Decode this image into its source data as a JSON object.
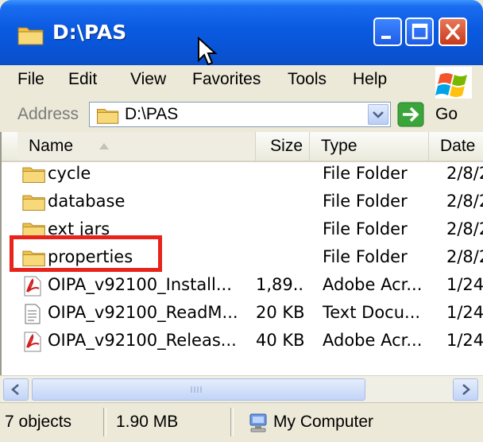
{
  "window": {
    "title": "D:\\PAS"
  },
  "menu": {
    "items": [
      "File",
      "Edit",
      "View",
      "Favorites",
      "Tools",
      "Help"
    ]
  },
  "address": {
    "label": "Address",
    "value": "D:\\PAS",
    "go_label": "Go"
  },
  "columns": {
    "name": "Name",
    "size": "Size",
    "type": "Type",
    "date": "Date"
  },
  "files": [
    {
      "name": "cycle",
      "size": "",
      "type": "File Folder",
      "date": "2/8/2",
      "icon": "folder-icon"
    },
    {
      "name": "database",
      "size": "",
      "type": "File Folder",
      "date": "2/8/2",
      "icon": "folder-icon"
    },
    {
      "name": "ext jars",
      "size": "",
      "type": "File Folder",
      "date": "2/8/2",
      "icon": "folder-icon"
    },
    {
      "name": "properties",
      "size": "",
      "type": "File Folder",
      "date": "2/8/2",
      "icon": "folder-icon"
    },
    {
      "name": "OIPA_v92100_Install...",
      "size": "1,89...",
      "type": "Adobe Acr...",
      "date": "1/24/",
      "icon": "pdf-icon"
    },
    {
      "name": "OIPA_v92100_ReadM...",
      "size": "20 KB",
      "type": "Text Docu...",
      "date": "1/24/",
      "icon": "text-document-icon"
    },
    {
      "name": "OIPA_v92100_Releas...",
      "size": "40 KB",
      "type": "Adobe Acr...",
      "date": "1/24/",
      "icon": "pdf-icon"
    }
  ],
  "status": {
    "objects": "7 objects",
    "size": "1.90 MB",
    "location": "My Computer"
  },
  "colors": {
    "titlebar": "#0a5ae0",
    "highlight": "#e8231c",
    "chrome": "#ece9d8"
  }
}
